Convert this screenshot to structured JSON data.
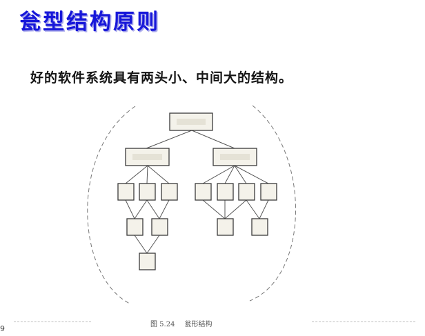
{
  "slide": {
    "title": "瓮型结构原则",
    "subtitle": "好的软件系统具有两头小、中间大的结构。",
    "page_number": "9"
  },
  "figure": {
    "number": "图 5.24",
    "caption": "瓮形结构"
  },
  "colors": {
    "title": "#1717d9",
    "box_fill": "#f4f2ea",
    "box_stroke": "#3a3a3a"
  }
}
